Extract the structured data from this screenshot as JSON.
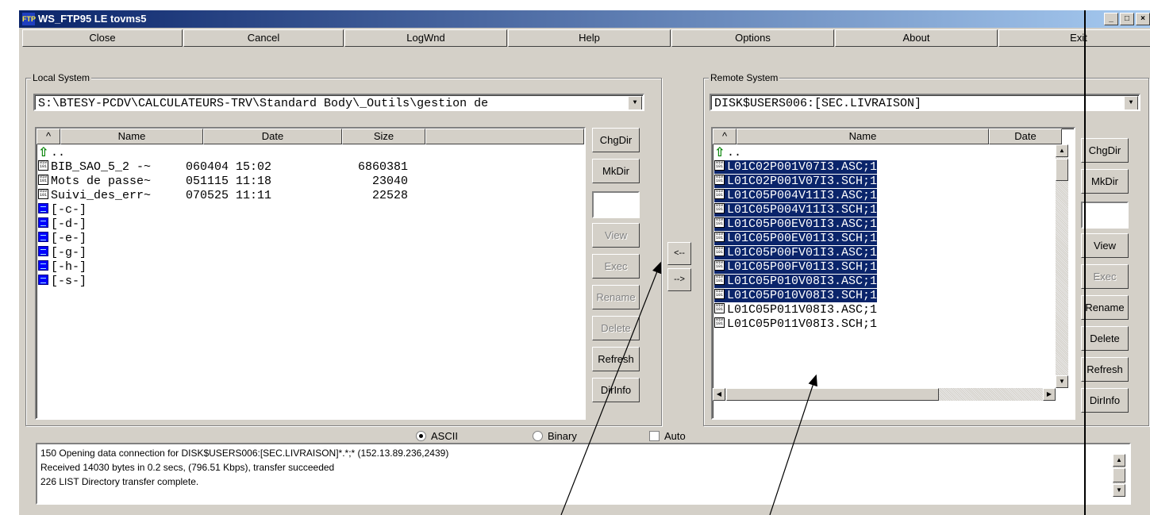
{
  "window": {
    "title": "WS_FTP95 LE tovms5",
    "app_icon_text": "FTP",
    "controls": {
      "minimize": "_",
      "maximize": "□",
      "close": "×"
    }
  },
  "toolbar": {
    "close": "Close",
    "cancel": "Cancel",
    "logwnd": "LogWnd",
    "help": "Help",
    "options": "Options",
    "about": "About",
    "exit": "Exit"
  },
  "local": {
    "group_label": "Local System",
    "path": "S:\\BTESY-PCDV\\CALCULATEURS-TRV\\Standard Body\\_Outils\\gestion de",
    "headers": {
      "sort": "^",
      "name": "Name",
      "date": "Date",
      "size": "Size"
    },
    "rows": [
      {
        "icon": "up",
        "name": "..",
        "date": "",
        "size": ""
      },
      {
        "icon": "bin",
        "name": "BIB_SAO_5_2 -~",
        "date": "060404 15:02",
        "size": "6860381"
      },
      {
        "icon": "bin",
        "name": "Mots de passe~",
        "date": "051115 11:18",
        "size": "23040"
      },
      {
        "icon": "bin",
        "name": "Suivi_des_err~",
        "date": "070525 11:11",
        "size": "22528"
      },
      {
        "icon": "dir",
        "name": "[-c-]",
        "date": "",
        "size": ""
      },
      {
        "icon": "dir",
        "name": "[-d-]",
        "date": "",
        "size": ""
      },
      {
        "icon": "dir",
        "name": "[-e-]",
        "date": "",
        "size": ""
      },
      {
        "icon": "dir",
        "name": "[-g-]",
        "date": "",
        "size": ""
      },
      {
        "icon": "dir",
        "name": "[-h-]",
        "date": "",
        "size": ""
      },
      {
        "icon": "dir",
        "name": "[-s-]",
        "date": "",
        "size": ""
      }
    ],
    "buttons": {
      "chgdir": "ChgDir",
      "mkdir": "MkDir",
      "view": "View",
      "exec": "Exec",
      "rename": "Rename",
      "delete": "Delete",
      "refresh": "Refresh",
      "dirinfo": "DirInfo"
    }
  },
  "transfer": {
    "to_local": "<--",
    "to_remote": "-->"
  },
  "remote": {
    "group_label": "Remote System",
    "path": "DISK$USERS006:[SEC.LIVRAISON]",
    "headers": {
      "sort": "^",
      "name": "Name",
      "date": "Date"
    },
    "rows": [
      {
        "icon": "up",
        "name": "..",
        "selected": false
      },
      {
        "icon": "bin",
        "name": "L01C02P001V07I3.ASC;1",
        "selected": true
      },
      {
        "icon": "bin",
        "name": "L01C02P001V07I3.SCH;1",
        "selected": true
      },
      {
        "icon": "bin",
        "name": "L01C05P004V11I3.ASC;1",
        "selected": true
      },
      {
        "icon": "bin",
        "name": "L01C05P004V11I3.SCH;1",
        "selected": true
      },
      {
        "icon": "bin",
        "name": "L01C05P00EV01I3.ASC;1",
        "selected": true
      },
      {
        "icon": "bin",
        "name": "L01C05P00EV01I3.SCH;1",
        "selected": true
      },
      {
        "icon": "bin",
        "name": "L01C05P00FV01I3.ASC;1",
        "selected": true
      },
      {
        "icon": "bin",
        "name": "L01C05P00FV01I3.SCH;1",
        "selected": true
      },
      {
        "icon": "bin",
        "name": "L01C05P010V08I3.ASC;1",
        "selected": true
      },
      {
        "icon": "bin",
        "name": "L01C05P010V08I3.SCH;1",
        "selected": true
      },
      {
        "icon": "bin",
        "name": "L01C05P011V08I3.ASC;1",
        "selected": false
      },
      {
        "icon": "bin",
        "name": "L01C05P011V08I3.SCH;1",
        "selected": false
      }
    ],
    "buttons": {
      "chgdir": "ChgDir",
      "mkdir": "MkDir",
      "view": "View",
      "exec": "Exec",
      "rename": "Rename",
      "delete": "Delete",
      "refresh": "Refresh",
      "dirinfo": "DirInfo"
    }
  },
  "mode": {
    "ascii": "ASCII",
    "binary": "Binary",
    "auto": "Auto",
    "selected": "ascii",
    "auto_checked": false
  },
  "log": [
    "150 Opening data connection for DISK$USERS006:[SEC.LIVRAISON]*.*;* (152.13.89.236,2439)",
    "Received 14030 bytes in 0.2 secs, (796.51 Kbps), transfer succeeded",
    "226 LIST Directory transfer complete."
  ],
  "colors": {
    "selection": "#0a246a",
    "face": "#d4d0c8",
    "title_start": "#0a246a",
    "title_end": "#a6caf0"
  }
}
